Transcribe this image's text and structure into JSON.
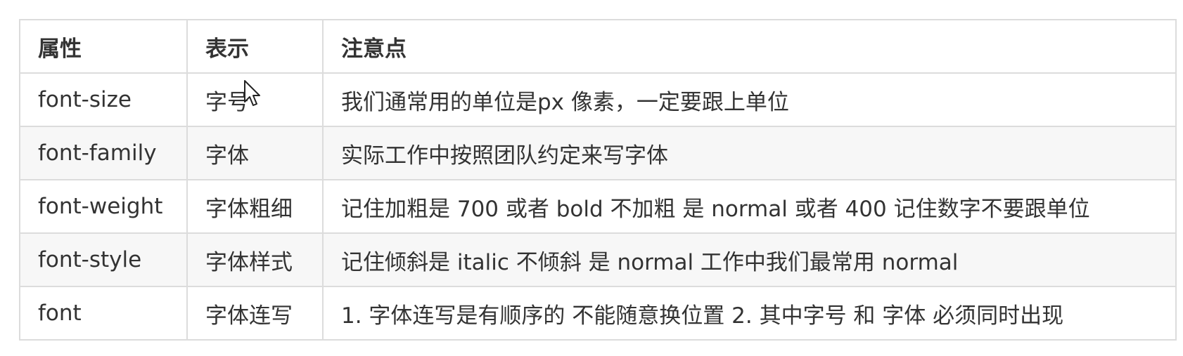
{
  "table": {
    "headers": [
      "属性",
      "表示",
      "注意点"
    ],
    "rows": [
      [
        "font-size",
        "字号",
        "我们通常用的单位是px 像素，一定要跟上单位"
      ],
      [
        "font-family",
        "字体",
        "实际工作中按照团队约定来写字体"
      ],
      [
        "font-weight",
        "字体粗细",
        "记住加粗是 700 或者 bold  不加粗 是 normal 或者  400  记住数字不要跟单位"
      ],
      [
        "font-style",
        "字体样式",
        "记住倾斜是 italic    不倾斜 是 normal  工作中我们最常用 normal"
      ],
      [
        "font",
        "字体连写",
        "1. 字体连写是有顺序的  不能随意换位置 2. 其中字号 和 字体 必须同时出现"
      ]
    ]
  },
  "cursor": {
    "icon": "mouse-pointer-icon"
  }
}
